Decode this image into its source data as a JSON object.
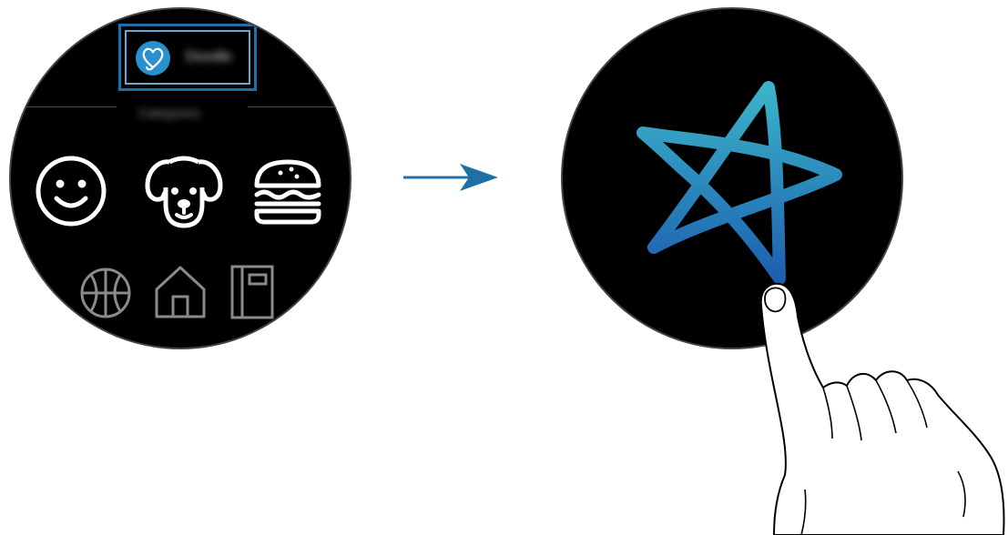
{
  "left_watch": {
    "mode": {
      "icon": "heart-icon",
      "label": "Doodle",
      "highlighted": true
    },
    "section_label": "Categories",
    "primary_icons": [
      "smiley-face-icon",
      "dog-face-icon",
      "burger-icon"
    ],
    "secondary_icons": [
      "basketball-icon",
      "home-icon",
      "notebook-icon"
    ]
  },
  "transition": {
    "icon": "arrow-right-icon"
  },
  "right_watch": {
    "drawing": "star-doodle",
    "gesture": "finger-draw-icon"
  },
  "colors": {
    "highlight": "#1f6fa8",
    "heart_bg": "#2a8fcf",
    "star_stroke": "#2ba0c4",
    "arrow": "#1f6fa8"
  }
}
